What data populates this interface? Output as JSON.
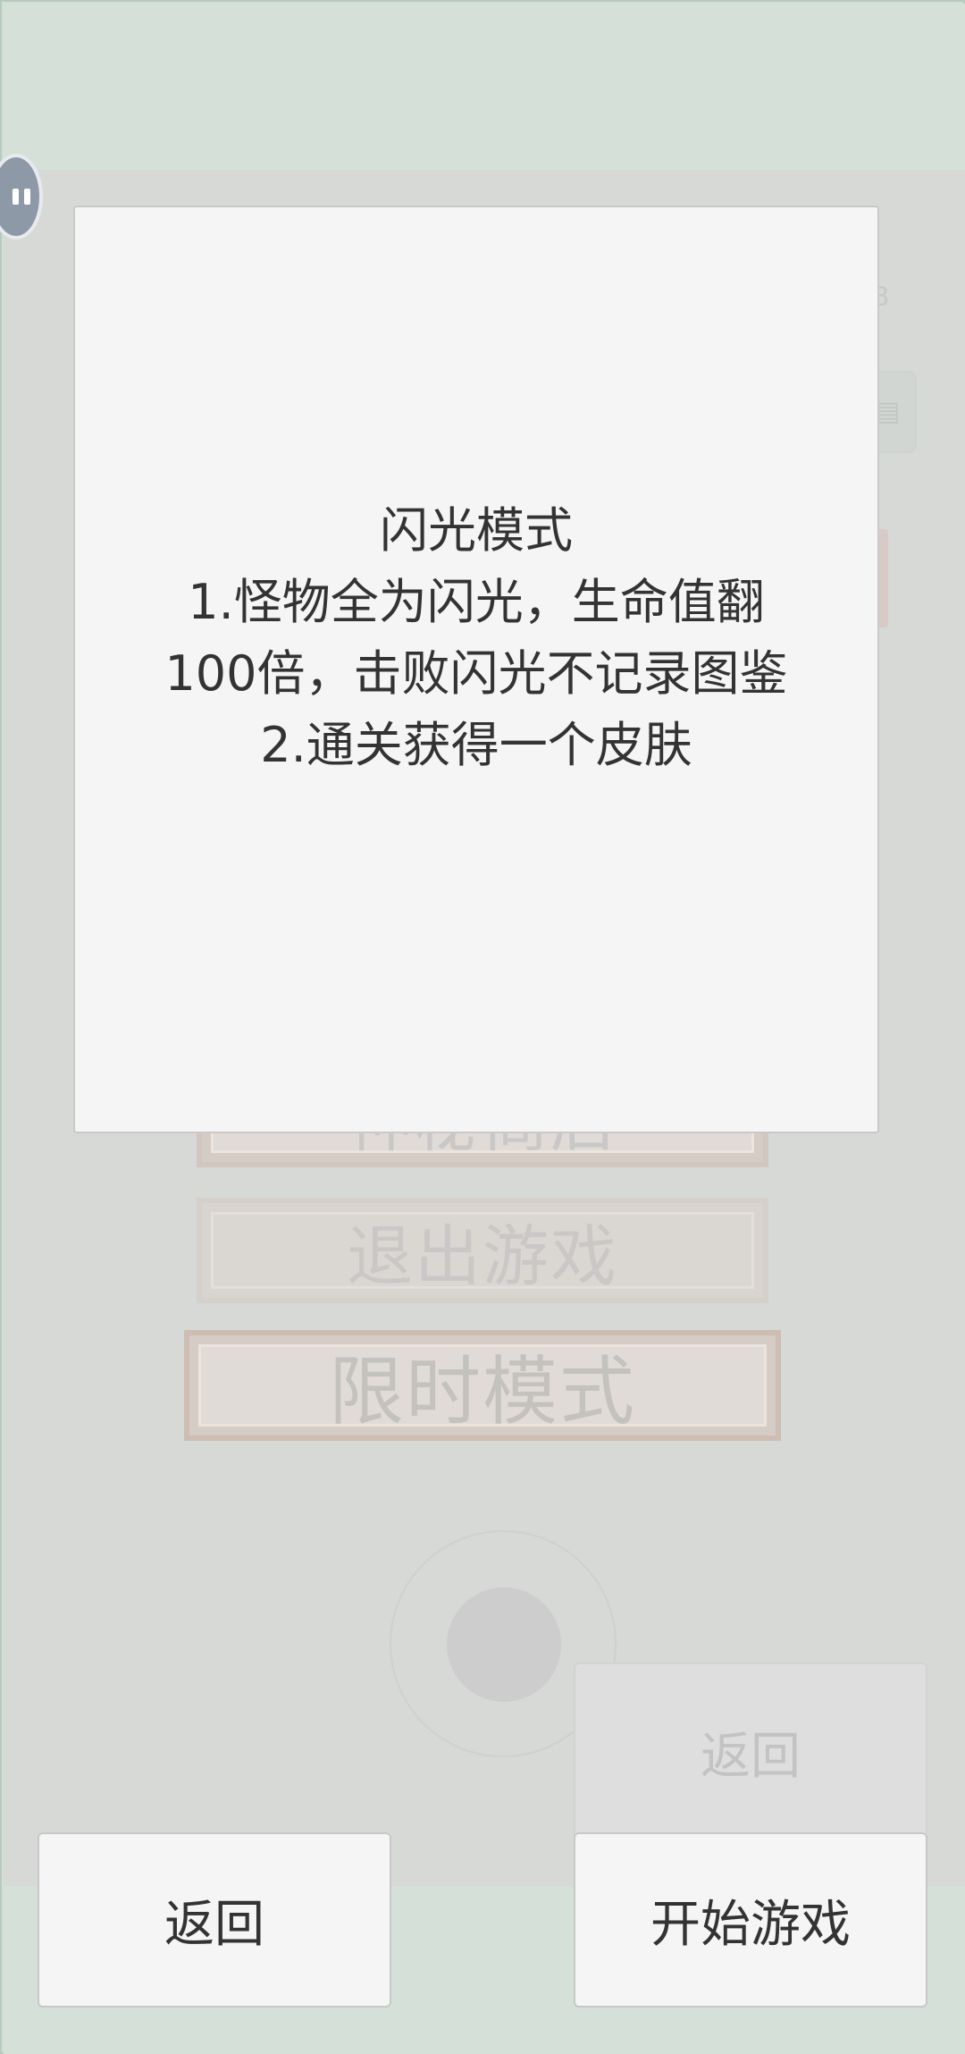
{
  "modal": {
    "title": "闪光模式",
    "lines": [
      "1.怪物全为闪光，生命值翻",
      "100倍，击败闪光不记录图鉴",
      "2.通关获得一个皮肤"
    ]
  },
  "buttons": {
    "back_label": "返回",
    "start_label": "开始游戏",
    "ghost_back_label": "返回"
  },
  "background": {
    "button_1_label": "神秘商店",
    "button_2_label": "退出游戏",
    "button_3_label": "限时模式",
    "side_text": "B"
  },
  "icons": {
    "pause": "pause-icon"
  }
}
